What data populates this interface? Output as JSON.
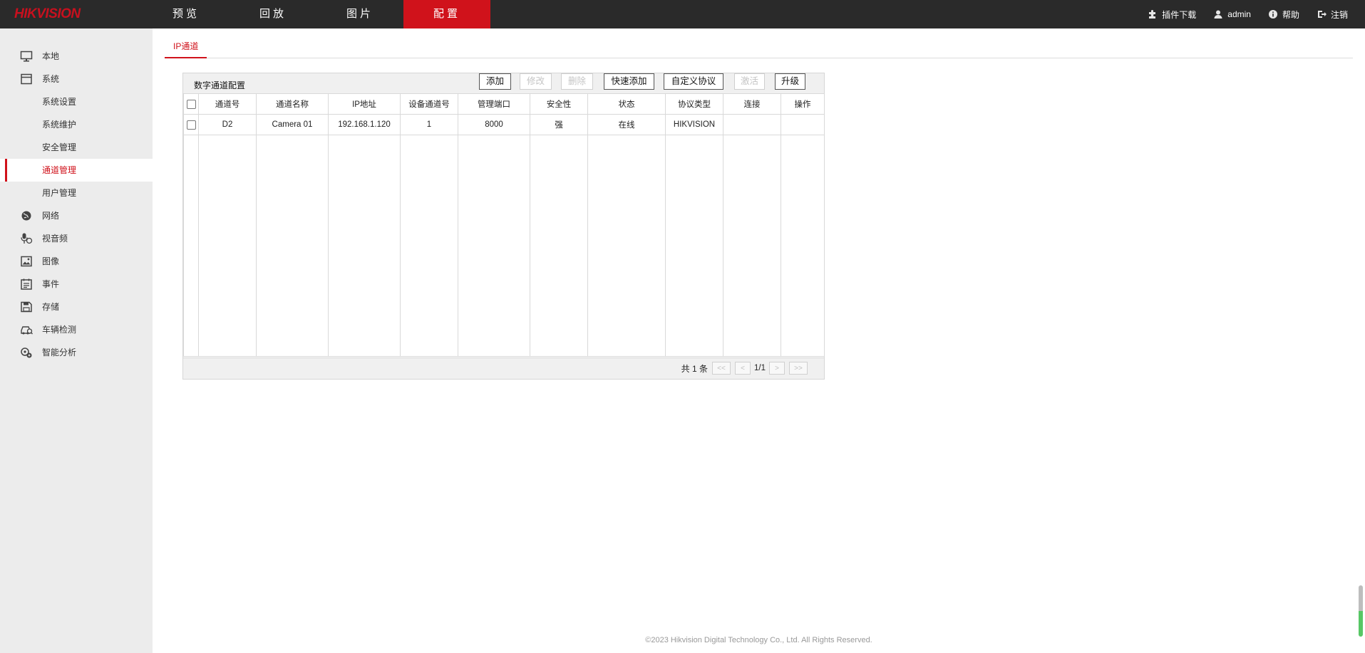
{
  "brand": {
    "logo": "HIKVISION",
    "accent": "#d0121b"
  },
  "nav": [
    {
      "label": "预览"
    },
    {
      "label": "回放"
    },
    {
      "label": "图片"
    },
    {
      "label": "配置",
      "active": true
    }
  ],
  "top_right": {
    "plugin": "插件下载",
    "user": "admin",
    "help": "帮助",
    "logout": "注销"
  },
  "sidebar": {
    "items": [
      {
        "label": "本地",
        "icon": "monitor-icon"
      },
      {
        "label": "系统",
        "icon": "system-icon"
      },
      {
        "label": "系统设置",
        "sub": true
      },
      {
        "label": "系统维护",
        "sub": true
      },
      {
        "label": "安全管理",
        "sub": true
      },
      {
        "label": "通道管理",
        "sub": true,
        "active": true
      },
      {
        "label": "用户管理",
        "sub": true
      },
      {
        "label": "网络",
        "icon": "globe-icon"
      },
      {
        "label": "视音频",
        "icon": "microphone-icon"
      },
      {
        "label": "图像",
        "icon": "image-icon"
      },
      {
        "label": "事件",
        "icon": "calendar-icon"
      },
      {
        "label": "存储",
        "icon": "save-icon"
      },
      {
        "label": "车辆检测",
        "icon": "vehicle-icon"
      },
      {
        "label": "智能分析",
        "icon": "smart-analysis-icon"
      }
    ]
  },
  "tabs": [
    {
      "label": "IP通道",
      "active": true
    }
  ],
  "panel": {
    "title": "数字通道配置",
    "buttons": {
      "add": "添加",
      "modify": "修改",
      "delete": "删除",
      "quick_add": "快速添加",
      "custom_protocol": "自定义协议",
      "activate": "激活",
      "upgrade": "升级"
    },
    "columns": [
      "通道号",
      "通道名称",
      "IP地址",
      "设备通道号",
      "管理端口",
      "安全性",
      "状态",
      "协议类型",
      "连接",
      "操作"
    ],
    "rows": [
      {
        "channel": "D2",
        "name": "Camera 01",
        "ip": "192.168.1.120",
        "device_channel": "1",
        "port": "8000",
        "security": "强",
        "status": "在线",
        "protocol": "HIKVISION",
        "connect": "",
        "action": ""
      }
    ],
    "pager": {
      "total": "共 1 条",
      "first": "<<",
      "prev": "<",
      "page": "1/1",
      "next": ">",
      "last": ">>"
    }
  },
  "footer": "©2023 Hikvision Digital Technology Co., Ltd. All Rights Reserved."
}
